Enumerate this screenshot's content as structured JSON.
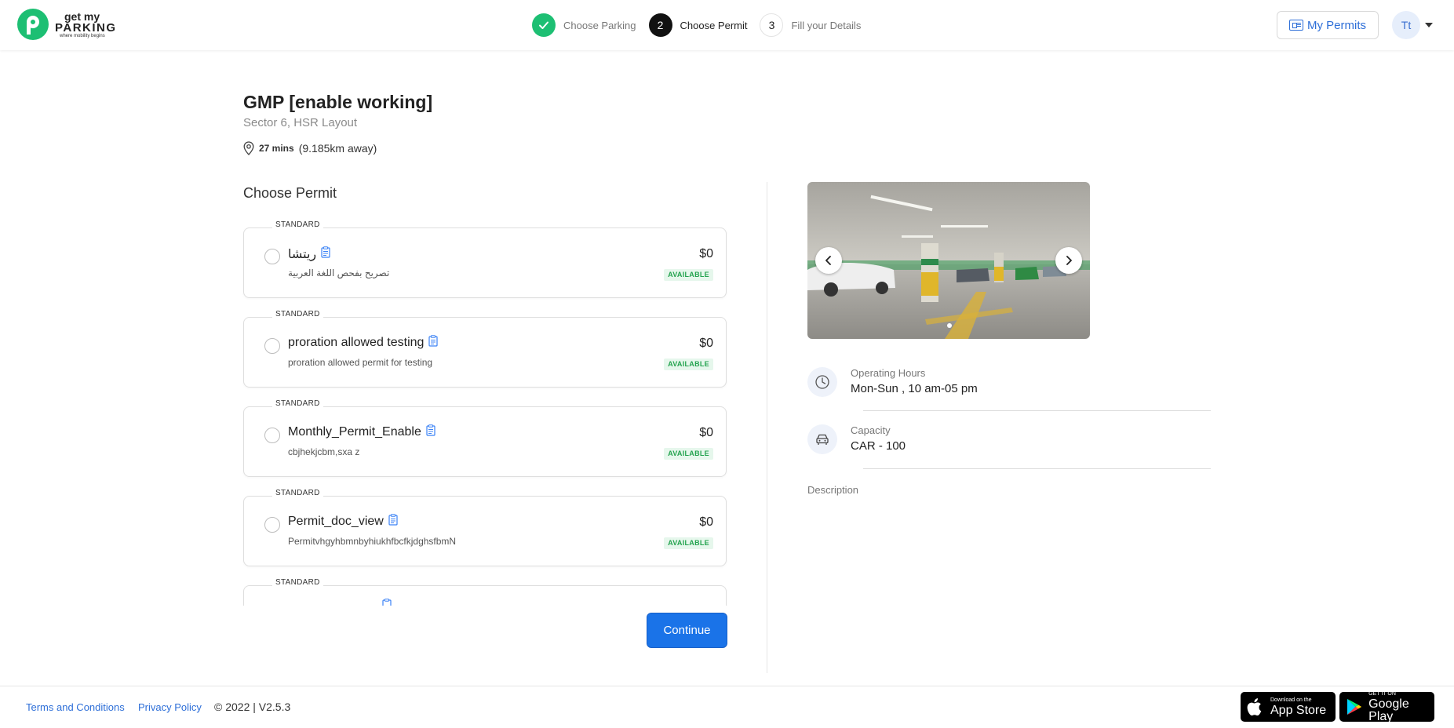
{
  "header": {
    "logo": {
      "line1": "get my",
      "line2": "PARKING",
      "tagline": "where mobility begins"
    },
    "steps": [
      {
        "num": "",
        "label": "Choose Parking",
        "state": "done"
      },
      {
        "num": "2",
        "label": "Choose Permit",
        "state": "active"
      },
      {
        "num": "3",
        "label": "Fill your Details",
        "state": "todo"
      }
    ],
    "my_permits_label": "My Permits",
    "avatar_initials": "Tt"
  },
  "location": {
    "title": "GMP [enable working]",
    "subtitle": "Sector 6, HSR Layout",
    "mins": "27 mins",
    "distance": "(9.185km away)"
  },
  "permits_section": {
    "title": "Choose Permit",
    "permits": [
      {
        "tag": "STANDARD",
        "name": "ريتشا",
        "desc": "تصريح بفحص اللغة العربية",
        "price": "$0",
        "status": "AVAILABLE"
      },
      {
        "tag": "STANDARD",
        "name": "proration allowed testing",
        "desc": "proration allowed permit for testing",
        "price": "$0",
        "status": "AVAILABLE"
      },
      {
        "tag": "STANDARD",
        "name": "Monthly_Permit_Enable",
        "desc": "cbjhekjcbm,sxa z",
        "price": "$0",
        "status": "AVAILABLE"
      },
      {
        "tag": "STANDARD",
        "name": "Permit_doc_view",
        "desc": "PermitvhgyhbmnbyhiukhfbcfkjdghsfbmN",
        "price": "$0",
        "status": "AVAILABLE"
      },
      {
        "tag": "STANDARD",
        "name": "",
        "desc": "",
        "price": "",
        "status": ""
      }
    ],
    "continue_label": "Continue"
  },
  "details": {
    "operating_hours_label": "Operating Hours",
    "operating_hours_value": "Mon-Sun , 10 am-05 pm",
    "capacity_label": "Capacity",
    "capacity_value": "CAR - 100",
    "description_label": "Description"
  },
  "footer": {
    "terms": "Terms and Conditions",
    "privacy": "Privacy Policy",
    "copyright": "© 2022 | V2.5.3",
    "appstore_small": "Download on the",
    "appstore_big": "App Store",
    "googleplay_small": "GET IT ON",
    "googleplay_big": "Google Play"
  },
  "colors": {
    "brand_green": "#1dbf73",
    "primary_blue": "#1a73e8",
    "available_green": "#24a34f"
  }
}
